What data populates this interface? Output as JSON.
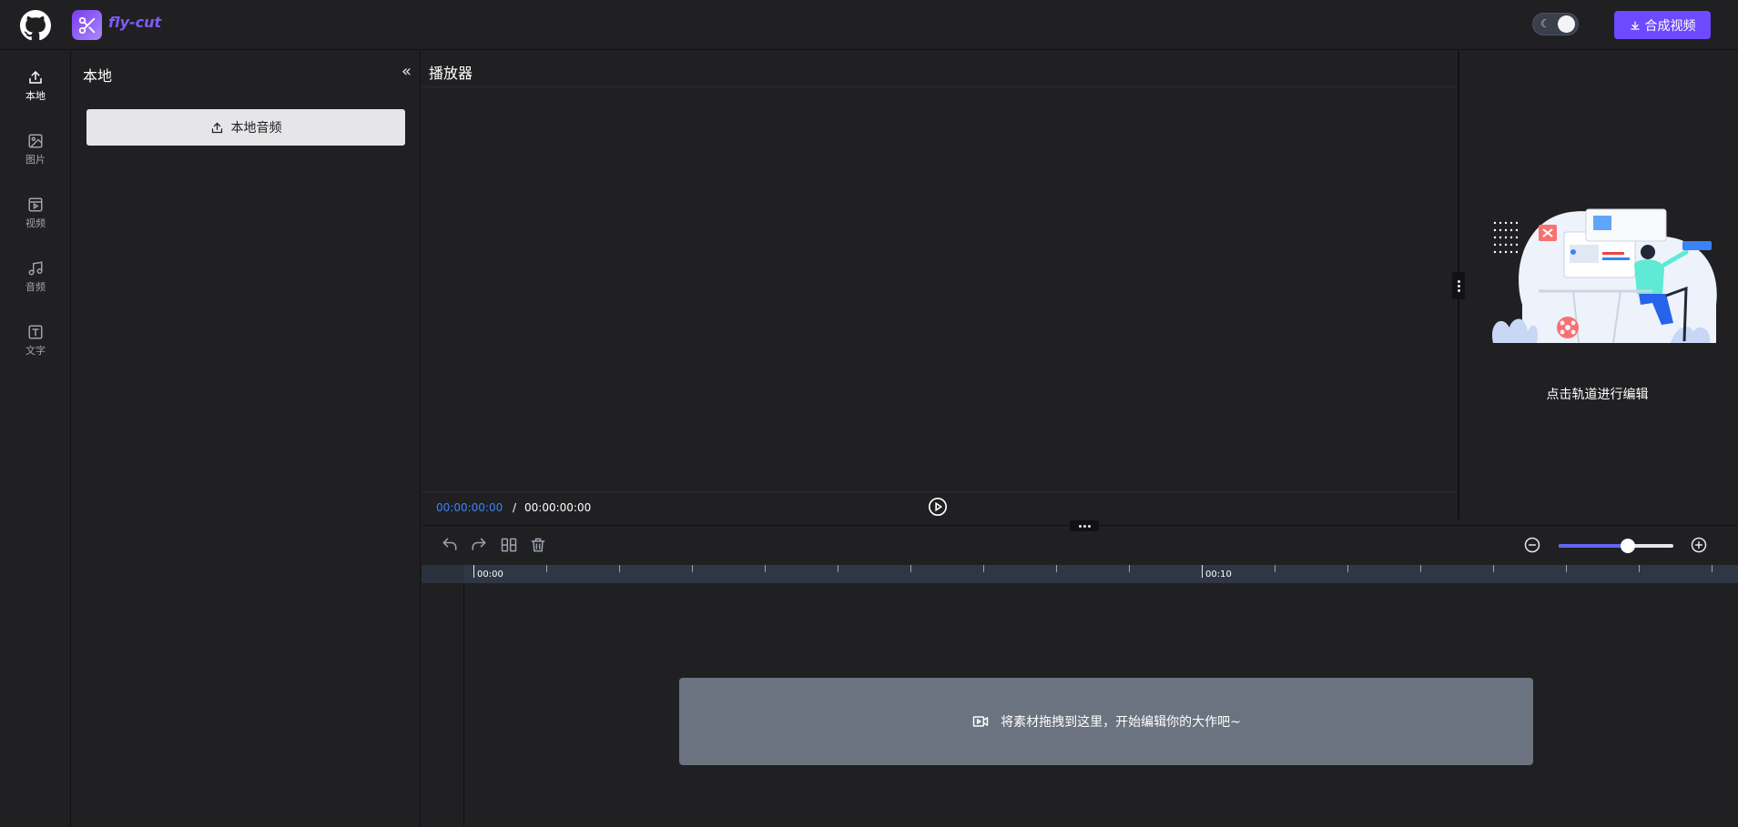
{
  "header": {
    "logo_text": "fly-cut",
    "export_label": "合成视频"
  },
  "nav": {
    "items": [
      {
        "label": "本地",
        "icon": "upload-icon",
        "active": true
      },
      {
        "label": "图片",
        "icon": "image-icon",
        "active": false
      },
      {
        "label": "视频",
        "icon": "video-icon",
        "active": false
      },
      {
        "label": "音频",
        "icon": "music-icon",
        "active": false
      },
      {
        "label": "文字",
        "icon": "text-icon",
        "active": false
      }
    ]
  },
  "resource_panel": {
    "title": "本地",
    "upload_label": "本地音频"
  },
  "player": {
    "title": "播放器",
    "current_time": "00:00:00:00",
    "separator": "/",
    "total_time": "00:00:00:00"
  },
  "attribute_panel": {
    "hint": "点击轨道进行编辑"
  },
  "timeline": {
    "zoom_level": 0.6,
    "ruler_labels": [
      "00:00",
      "00:10"
    ],
    "drop_hint": "将素材拖拽到这里，开始编辑你的大作吧~"
  },
  "colors": {
    "accent": "#6d4aff",
    "time_highlight": "#3b82f6",
    "background": "#202023"
  }
}
